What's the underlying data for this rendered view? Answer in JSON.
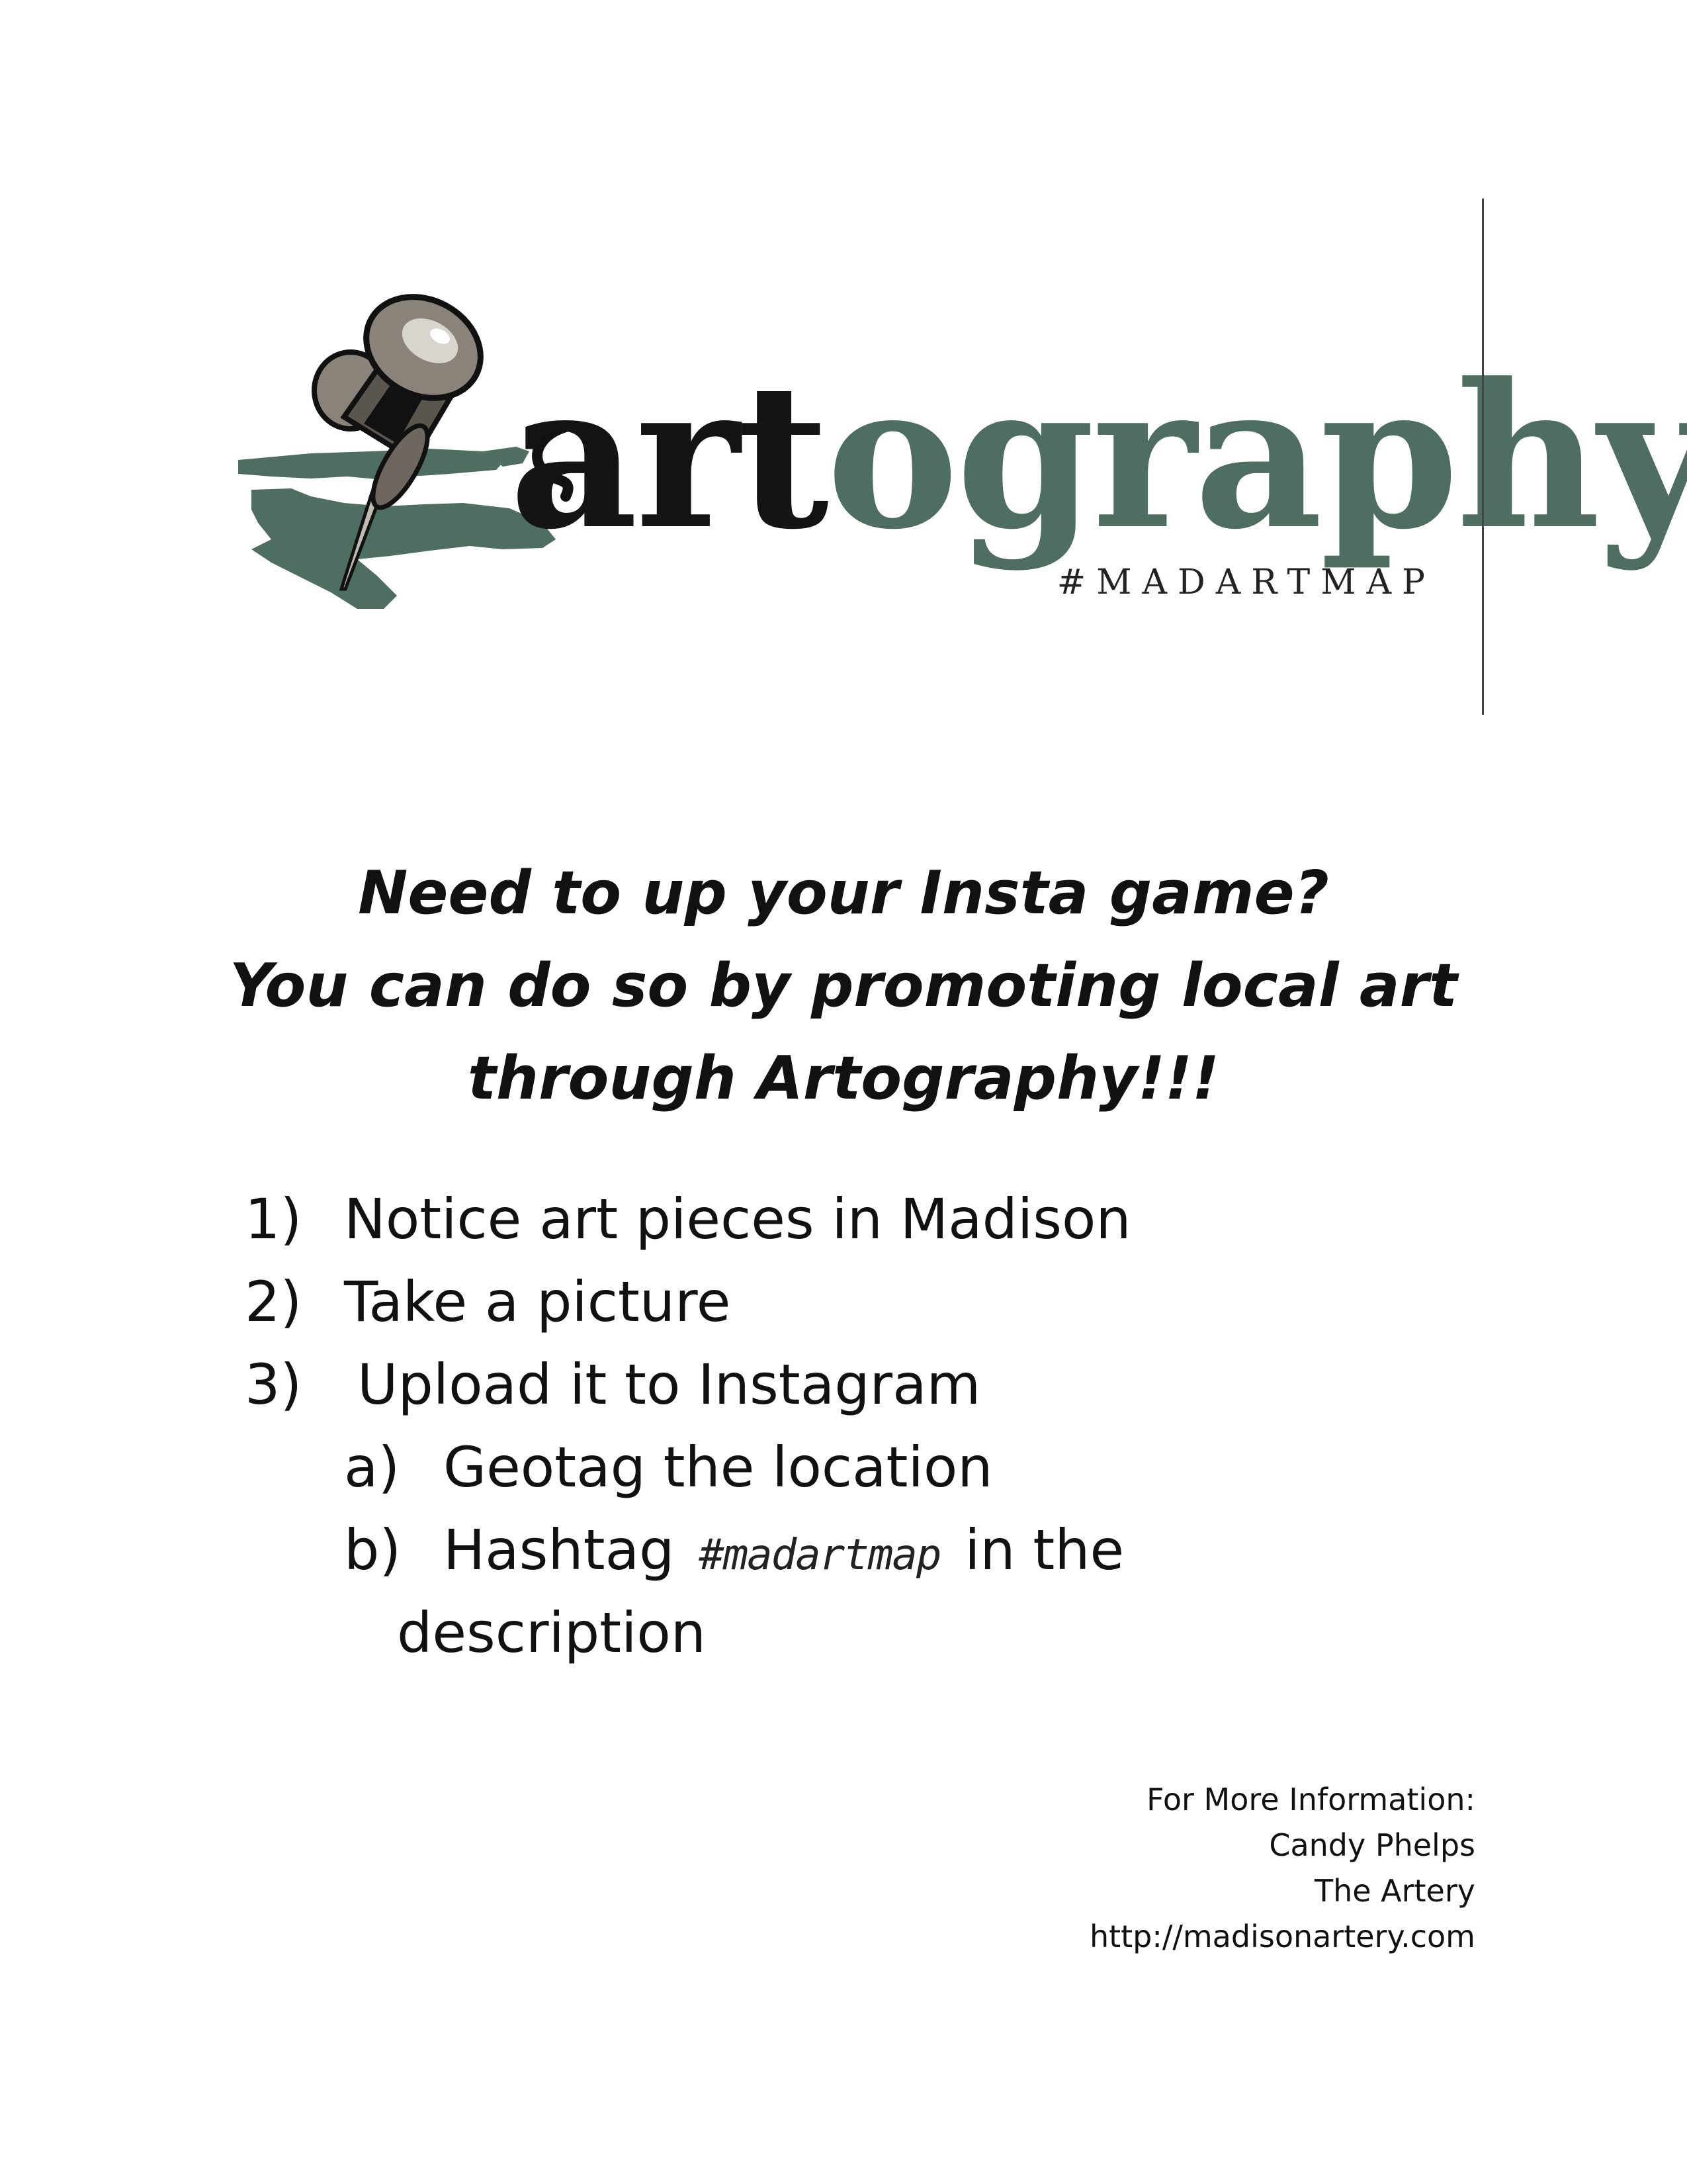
{
  "logo": {
    "word_dark": "art",
    "word_green": "ography",
    "tagline": "#MADARTMAP",
    "colors": {
      "dark": "#141414",
      "green": "#4e6e61"
    }
  },
  "headline": {
    "line1": "Need to up your Insta game?",
    "line2": "You can do so by promoting local art",
    "line3": "through Artography!!!"
  },
  "steps": {
    "s1": {
      "num": "1)",
      "text": "Notice art pieces in Madison"
    },
    "s2": {
      "num": "2)",
      "text": "Take a picture"
    },
    "s3": {
      "num": "3)",
      "text": "Upload it to Instagram"
    },
    "sa": {
      "num": "a)",
      "text": "Geotag the location"
    },
    "sb": {
      "num": "b)",
      "text_before": "Hashtag",
      "hashtag": "#madartmap",
      "text_after": "in the",
      "continuation": "description"
    }
  },
  "contact": {
    "line1": "For More Information:",
    "line2": "Candy Phelps",
    "line3": "The Artery",
    "line4": "http://madisonartery.com"
  }
}
